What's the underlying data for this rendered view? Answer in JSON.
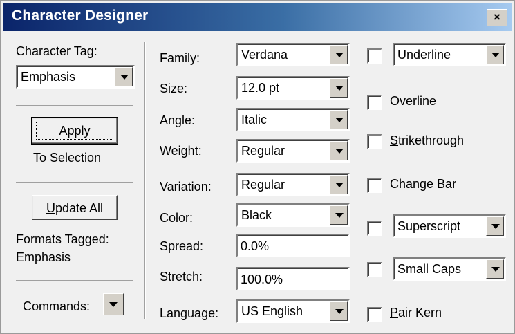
{
  "window": {
    "title": "Character Designer",
    "close_label": "×"
  },
  "left": {
    "tag_label": "Character Tag:",
    "tag_value": "Emphasis",
    "apply_button": {
      "pre": "",
      "u": "A",
      "post": "pply"
    },
    "to_selection": "To Selection",
    "update_all_button": {
      "u": "U",
      "post": "pdate All"
    },
    "formats_tagged_label": "Formats Tagged:",
    "formats_tagged_value": "Emphasis",
    "commands_label": "Commands:"
  },
  "props": {
    "family": {
      "label": "Family:",
      "value": "Verdana"
    },
    "size": {
      "label": "Size:",
      "value": "12.0 pt"
    },
    "angle": {
      "label": "Angle:",
      "value": "Italic"
    },
    "weight": {
      "label": "Weight:",
      "value": "Regular"
    },
    "variation": {
      "label": "Variation:",
      "value": "Regular"
    },
    "color": {
      "label": "Color:",
      "value": "Black"
    },
    "spread": {
      "label": "Spread:",
      "value": "0.0%"
    },
    "stretch": {
      "label": "Stretch:",
      "value": "100.0%"
    },
    "language": {
      "label": "Language:",
      "value": "US English"
    }
  },
  "effects": {
    "underline": {
      "value": "Underline"
    },
    "overline": {
      "u": "O",
      "post": "verline"
    },
    "strikethrough": {
      "u": "S",
      "post": "trikethrough"
    },
    "change_bar": {
      "u": "C",
      "post": "hange Bar"
    },
    "superscript": {
      "value": "Superscript"
    },
    "small_caps": {
      "value": "Small Caps"
    },
    "pair_kern": {
      "u": "P",
      "post": "air Kern"
    }
  }
}
